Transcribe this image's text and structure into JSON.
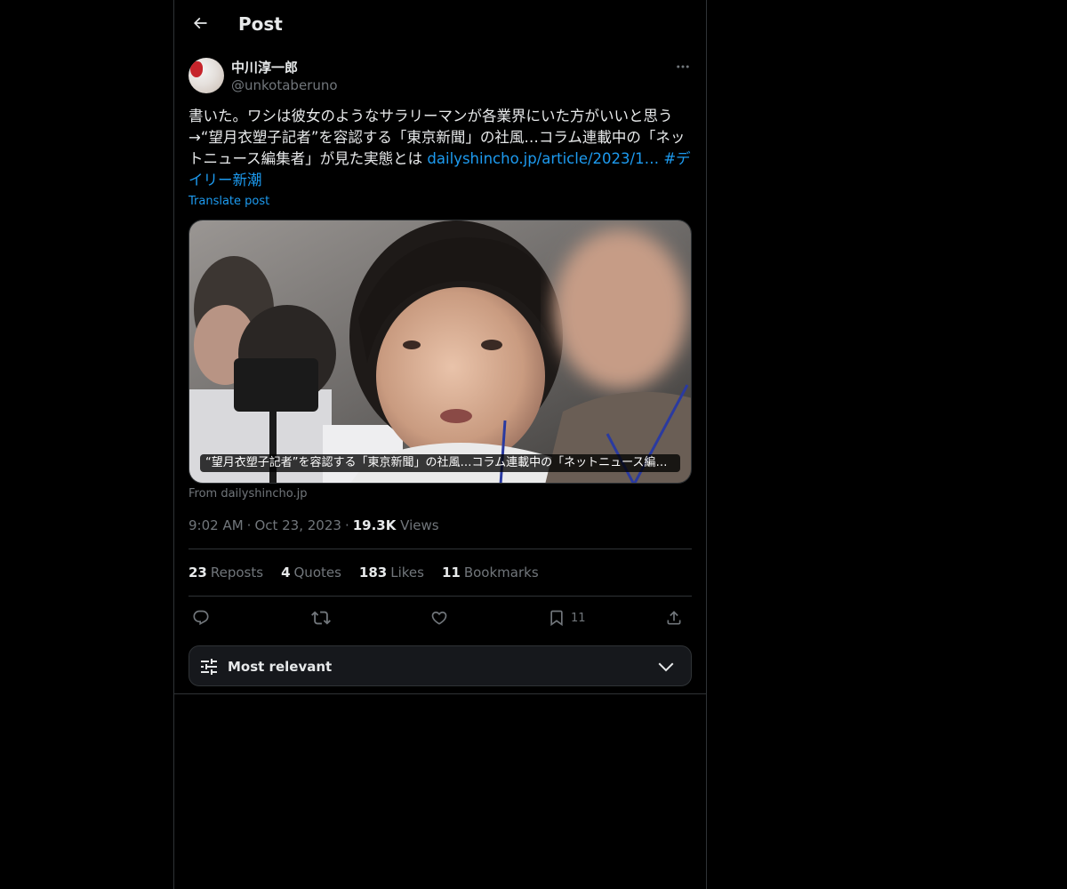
{
  "header": {
    "back_icon": "arrow-left-icon",
    "title": "Post"
  },
  "author": {
    "display_name": "中川淳一郎",
    "handle": "@unkotaberuno",
    "more_icon": "more-horizontal-icon"
  },
  "tweet": {
    "text_main": "書いた。ワシは彼女のようなサラリーマンが各業界にいた方がいいと思う→“望月衣塑子記者”を容認する「東京新聞」の社風…コラム連載中の「ネットニュース編集者」が見た実態とは ",
    "link_text": "dailyshincho.jp/article/2023/1…",
    "hashtag_text": "#デイリー新潮",
    "translate_label": "Translate post"
  },
  "card": {
    "caption": "“望月衣塑子記者”を容認する「東京新聞」の社風…コラム連載中の「ネットニュース編集…",
    "source": "From dailyshincho.jp"
  },
  "meta": {
    "time": "9:02 AM",
    "date": "Oct 23, 2023",
    "views_count": "19.3K",
    "views_label": "Views"
  },
  "stats": {
    "reposts_count": "23",
    "reposts_label": "Reposts",
    "quotes_count": "4",
    "quotes_label": "Quotes",
    "likes_count": "183",
    "likes_label": "Likes",
    "bookmarks_count": "11",
    "bookmarks_label": "Bookmarks"
  },
  "actions": {
    "reply_icon": "reply-icon",
    "repost_icon": "repost-icon",
    "like_icon": "heart-icon",
    "bookmark_icon": "bookmark-icon",
    "bookmark_count": "11",
    "share_icon": "share-icon"
  },
  "sort": {
    "label": "Most relevant",
    "icon": "sliders-icon",
    "chevron": "chevron-down-icon"
  },
  "colors": {
    "background": "#000000",
    "text": "#e7e9ea",
    "secondary": "#71767b",
    "accent": "#1d9bf0",
    "border": "#2f3336"
  }
}
